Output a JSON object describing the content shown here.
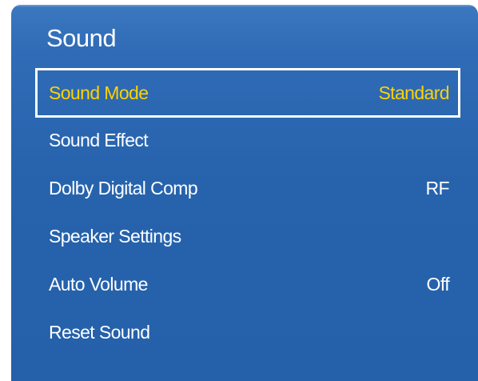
{
  "menu": {
    "title": "Sound",
    "items": [
      {
        "label": "Sound Mode",
        "value": "Standard",
        "selected": true
      },
      {
        "label": "Sound Effect",
        "value": ""
      },
      {
        "label": "Dolby Digital Comp",
        "value": "RF"
      },
      {
        "label": "Speaker Settings",
        "value": ""
      },
      {
        "label": "Auto Volume",
        "value": "Off"
      },
      {
        "label": "Reset Sound",
        "value": ""
      }
    ]
  },
  "colors": {
    "panel": "#2763ad",
    "highlight_text": "#ffd200",
    "text": "#ffffff",
    "focus_border": "#ffffff"
  }
}
